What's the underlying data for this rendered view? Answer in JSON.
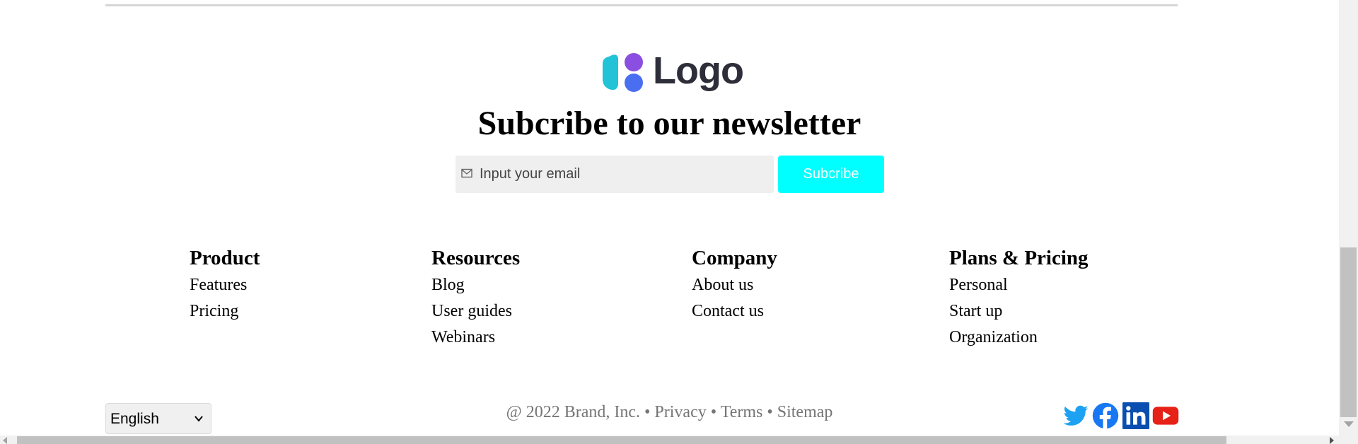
{
  "brand": {
    "logo_text": "Logo"
  },
  "newsletter": {
    "title": "Subcribe to our newsletter",
    "email_placeholder": "Input your email",
    "email_value": "",
    "subscribe_label": "Subcribe",
    "accent_color": "#00ffff"
  },
  "footer_columns": [
    {
      "heading": "Product",
      "links": [
        "Features",
        "Pricing"
      ]
    },
    {
      "heading": "Resources",
      "links": [
        "Blog",
        "User guides",
        "Webinars"
      ]
    },
    {
      "heading": "Company",
      "links": [
        "About us",
        "Contact us"
      ]
    },
    {
      "heading": "Plans & Pricing",
      "links": [
        "Personal",
        "Start up",
        "Organization"
      ]
    }
  ],
  "language": {
    "selected": "English"
  },
  "legal": {
    "copyright": "@ 2022 Brand, Inc.",
    "separator": "•",
    "privacy": "Privacy",
    "terms": "Terms",
    "sitemap": "Sitemap"
  },
  "social": [
    {
      "icon": "twitter-icon",
      "color": "#1da1f2"
    },
    {
      "icon": "facebook-icon",
      "color": "#1877f2"
    },
    {
      "icon": "linkedin-icon",
      "color": "#0a66c2"
    },
    {
      "icon": "youtube-icon",
      "color": "#ff0000"
    }
  ]
}
